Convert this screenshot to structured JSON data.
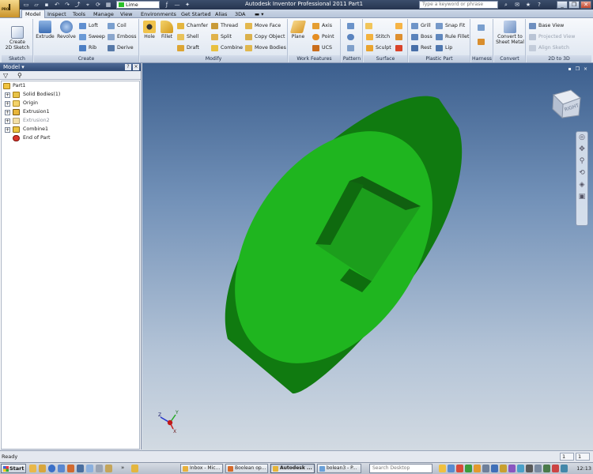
{
  "titlebar": {
    "title": "Autodesk Inventor Professional 2011   Part1",
    "color_value": "Lime",
    "search_placeholder": "Type a keyword or phrase",
    "app_button": "I",
    "app_button_sub": "PRO"
  },
  "tabs": [
    "Model",
    "Inspect",
    "Tools",
    "Manage",
    "View",
    "Environments",
    "Get Started",
    "Alias",
    "3DA"
  ],
  "ribbon": {
    "sketch": {
      "label": "Sketch",
      "create_sketch": "Create\n2D Sketch"
    },
    "create": {
      "label": "Create",
      "extrude": "Extrude",
      "revolve": "Revolve",
      "loft": "Loft",
      "sweep": "Sweep",
      "rib": "Rib",
      "coil": "Coil",
      "emboss": "Emboss",
      "derive": "Derive"
    },
    "modify": {
      "label": "Modify",
      "hole": "Hole",
      "fillet": "Fillet",
      "chamfer": "Chamfer",
      "shell": "Shell",
      "draft": "Draft",
      "thread": "Thread",
      "split": "Split",
      "combine": "Combine",
      "move_face": "Move Face",
      "copy_object": "Copy Object",
      "move_bodies": "Move Bodies"
    },
    "work_features": {
      "label": "Work Features",
      "plane": "Plane",
      "axis": "Axis",
      "point": "Point",
      "ucs": "UCS"
    },
    "pattern": {
      "label": "Pattern"
    },
    "surface": {
      "label": "Surface",
      "stitch": "Stitch",
      "sculpt": "Sculpt"
    },
    "plastic_part": {
      "label": "Plastic Part",
      "grill": "Grill",
      "boss": "Boss",
      "rest": "Rest",
      "snap_fit": "Snap Fit",
      "rule_fillet": "Rule Fillet",
      "lip": "Lip"
    },
    "harness": {
      "label": "Harness"
    },
    "convert": {
      "label": "Convert",
      "convert_sheet_metal": "Convert to\nSheet Metal"
    },
    "twod_to_3d": {
      "label": "2D to 3D",
      "base_view": "Base View",
      "projected_view": "Projected View",
      "align_sketch": "Align Sketch"
    }
  },
  "browser": {
    "title": "Model",
    "tree": [
      {
        "label": "Part1"
      },
      {
        "label": "Solid Bodies(1)"
      },
      {
        "label": "Origin"
      },
      {
        "label": "Extrusion1"
      },
      {
        "label": "Extrusion2"
      },
      {
        "label": "Combine1"
      },
      {
        "label": "End of Part"
      }
    ]
  },
  "viewport": {
    "viewcube_label": "RIGHT",
    "part_color": "#1fb51f"
  },
  "status": {
    "text": "Ready",
    "num1": "1",
    "num2": "1"
  },
  "taskbar": {
    "start": "Start",
    "buttons": [
      "Inbox - Mic...",
      "Boolean op...",
      "Autodesk ...",
      "bolean3 - P..."
    ],
    "search_placeholder": "Search Desktop",
    "clock": "12:13"
  }
}
